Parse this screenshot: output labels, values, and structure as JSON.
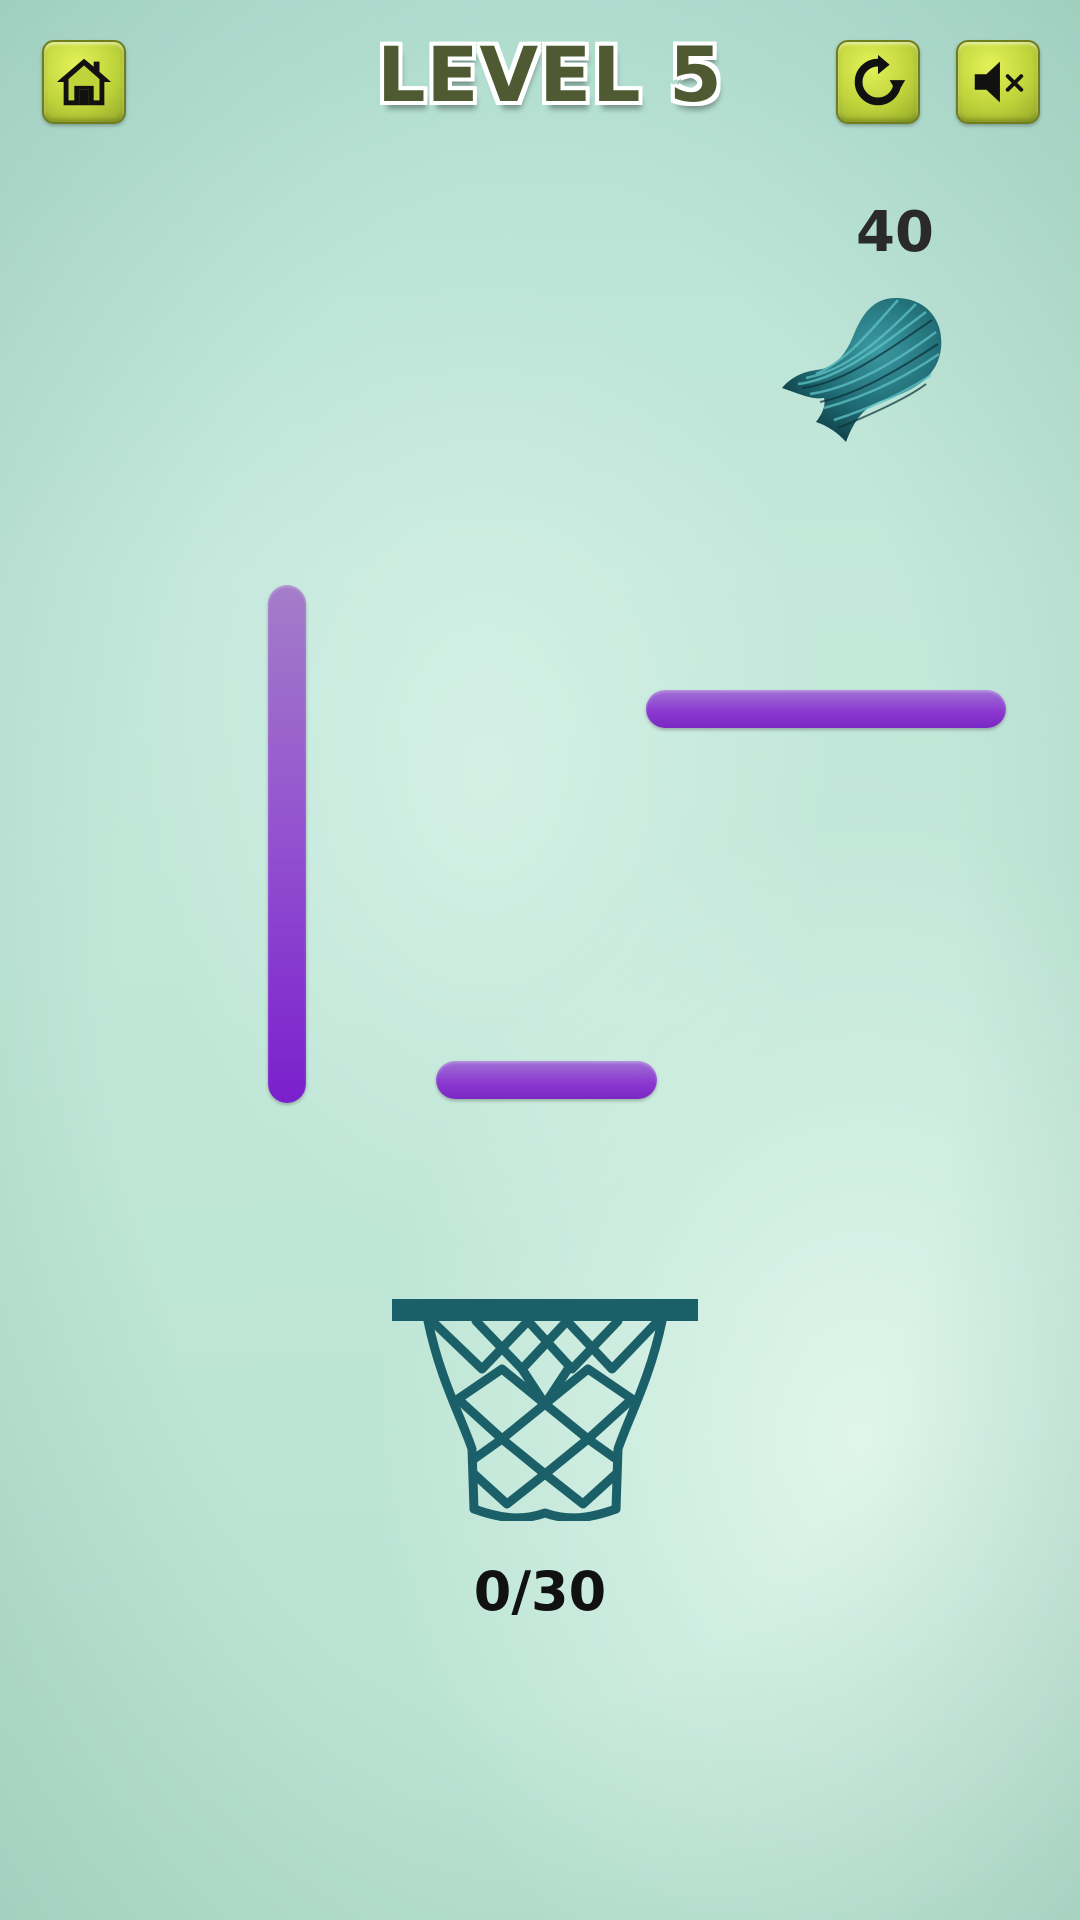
{
  "hud": {
    "level_title": "LEVEL 5",
    "home_icon": "home-icon",
    "restart_icon": "restart-icon",
    "mute_icon": "speaker-muted-icon",
    "button_color": "#bfd43a"
  },
  "balloon": {
    "water_amount": "40",
    "color": "#1f6b74"
  },
  "platforms": {
    "color": "#8a3fd0"
  },
  "hoop": {
    "progress_text": "0/30",
    "color": "#1b6068"
  }
}
